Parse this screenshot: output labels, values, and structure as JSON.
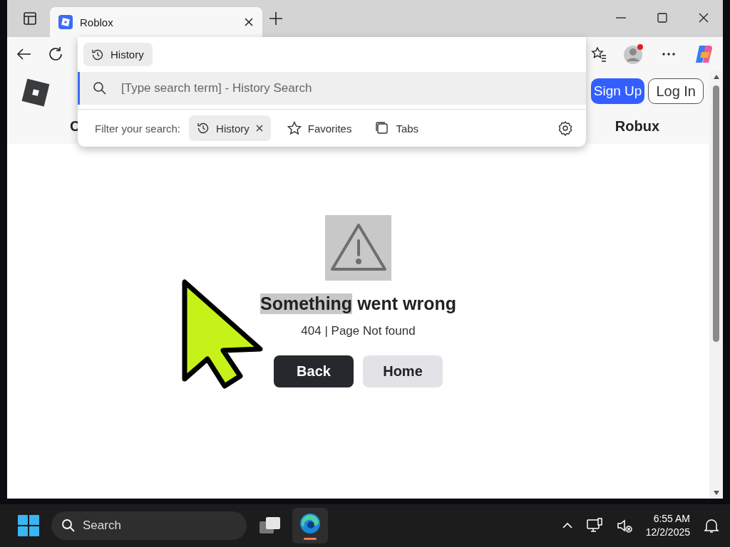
{
  "browser": {
    "tab": {
      "title": "Roblox"
    }
  },
  "omnibox_dropdown": {
    "scope_chip": "History",
    "search": {
      "placeholder": "[Type search term] - History Search"
    },
    "filter_label": "Filter your search:",
    "filters": [
      {
        "label": "History",
        "selected": true,
        "kind": "history"
      },
      {
        "label": "Favorites",
        "selected": false,
        "kind": "favorites"
      },
      {
        "label": "Tabs",
        "selected": false,
        "kind": "tabs"
      }
    ]
  },
  "site_header": {
    "buttons": [
      {
        "label": "Sign Up",
        "kind": "primary"
      },
      {
        "label": "Log In",
        "kind": "outline"
      }
    ],
    "nav": [
      "C",
      "Robux"
    ]
  },
  "error": {
    "title_selected": "Something",
    "title_rest": "went wrong",
    "message": "404 | Page Not found",
    "buttons": [
      {
        "label": "Back",
        "kind": "primary"
      },
      {
        "label": "Home",
        "kind": "secondary"
      }
    ]
  },
  "taskbar": {
    "search": {
      "placeholder": "Search"
    },
    "time": "6:55 AM",
    "date": "12/2/2025"
  }
}
